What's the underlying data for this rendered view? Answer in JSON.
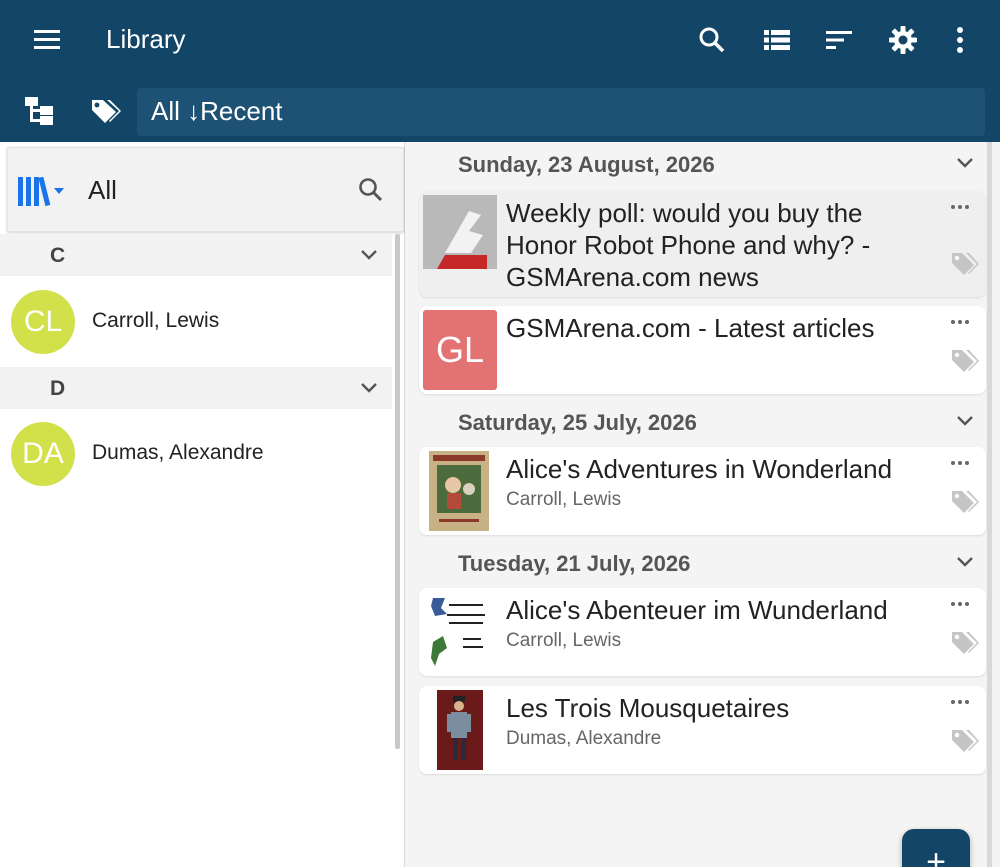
{
  "app": {
    "title": "Library",
    "icons": [
      "menu-icon",
      "search-icon",
      "list-view-icon",
      "sort-icon",
      "settings-icon",
      "more-vert-icon"
    ]
  },
  "filter": {
    "label": "All ↓Recent",
    "icons": [
      "tree-view-icon",
      "tags-icon"
    ]
  },
  "sidebar": {
    "filter_label": "All",
    "groups": [
      {
        "letter": "C",
        "authors": [
          {
            "initials": "CL",
            "name": "Carroll, Lewis"
          }
        ]
      },
      {
        "letter": "D",
        "authors": [
          {
            "initials": "DA",
            "name": "Dumas, Alexandre"
          }
        ]
      }
    ]
  },
  "main": {
    "sections": [
      {
        "date": "Sunday, 23 August, 2026",
        "items": [
          {
            "title": "Weekly poll: would you buy the Honor Robot Phone and why? - GSMArena.com news",
            "subtitle": "",
            "thumb": "gsmarena-news-thumbnail"
          },
          {
            "title": "GSMArena.com - Latest articles",
            "subtitle": "",
            "thumb": "GL"
          }
        ]
      },
      {
        "date": "Saturday, 25 July, 2026",
        "items": [
          {
            "title": "Alice's Adventures in Wonderland",
            "subtitle": "Carroll, Lewis",
            "thumb": "book-cover-alice-en"
          }
        ]
      },
      {
        "date": "Tuesday, 21 July, 2026",
        "items": [
          {
            "title": "Alice's Abenteuer im Wunderland",
            "subtitle": "Carroll, Lewis",
            "thumb": "book-cover-alice-de"
          },
          {
            "title": "Les Trois Mousquetaires",
            "subtitle": "Dumas, Alexandre",
            "thumb": "book-cover-musketeers"
          }
        ]
      }
    ],
    "fab_label": "+"
  },
  "colors": {
    "appbar": "#134566",
    "avatar": "#d2e14a",
    "gl_thumb": "#e37272",
    "accent_blue": "#1a73e8"
  }
}
